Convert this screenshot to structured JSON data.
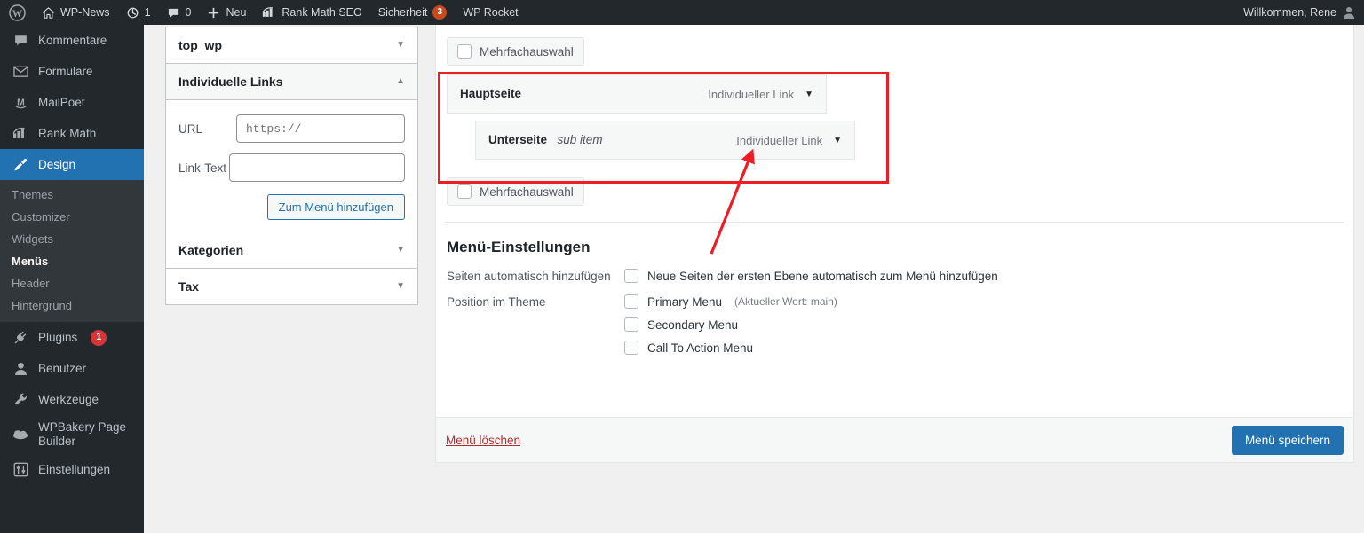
{
  "adminbar": {
    "logo": "wordpress-logo",
    "items": [
      {
        "icon": "home-icon",
        "label": "WP-News"
      },
      {
        "icon": "update-icon",
        "label": "1"
      },
      {
        "icon": "comment-icon",
        "label": "0"
      },
      {
        "icon": "plus-icon",
        "label": "Neu"
      },
      {
        "icon": "rankmath-icon",
        "label": "Rank Math SEO"
      },
      {
        "icon": "",
        "label": "Sicherheit",
        "badge": "3"
      },
      {
        "icon": "",
        "label": "WP Rocket"
      }
    ],
    "greeting": "Willkommen, Rene"
  },
  "sidebar": {
    "items": [
      {
        "label": "Kommentare",
        "icon": "comment-icon"
      },
      {
        "label": "Formulare",
        "icon": "envelope-icon"
      },
      {
        "label": "MailPoet",
        "icon": "mailpoet-icon"
      },
      {
        "label": "Rank Math",
        "icon": "rankmath-icon"
      },
      {
        "label": "Design",
        "icon": "brush-icon",
        "current": true
      },
      {
        "label": "Plugins",
        "icon": "plug-icon",
        "badge": "1"
      },
      {
        "label": "Benutzer",
        "icon": "user-icon"
      },
      {
        "label": "Werkzeuge",
        "icon": "wrench-icon"
      },
      {
        "label": "WPBakery Page Builder",
        "icon": "cloud-icon"
      },
      {
        "label": "Einstellungen",
        "icon": "sliders-icon"
      }
    ],
    "submenu": [
      {
        "label": "Themes",
        "active": false
      },
      {
        "label": "Customizer",
        "active": false
      },
      {
        "label": "Widgets",
        "active": false
      },
      {
        "label": "Menüs",
        "active": true
      },
      {
        "label": "Header",
        "active": false
      },
      {
        "label": "Hintergrund",
        "active": false
      }
    ]
  },
  "metaboxes": {
    "top_wp": {
      "title": "top_wp",
      "toggle": "chevron-down-icon"
    },
    "custom_links": {
      "title": "Individuelle Links",
      "toggle": "chevron-up-icon",
      "url_label": "URL",
      "url_placeholder": "https://",
      "url_value": "",
      "text_label": "Link-Text",
      "text_value": "",
      "text_placeholder": "",
      "add_button": "Zum Menü hinzufügen"
    },
    "categories": {
      "title": "Kategorien",
      "toggle": "chevron-down-icon"
    },
    "tax": {
      "title": "Tax",
      "toggle": "chevron-down-icon"
    }
  },
  "menu_panel": {
    "multiselect_top": "Mehrfachauswahl",
    "multiselect_bottom": "Mehrfachauswahl",
    "items": [
      {
        "title": "Hauptseite",
        "sub": "",
        "type": "Individueller Link",
        "arrow": "chevron-down-icon",
        "depth": 0
      },
      {
        "title": "Unterseite",
        "sub": "sub item",
        "type": "Individueller Link",
        "arrow": "chevron-down-icon",
        "depth": 1
      }
    ],
    "settings": {
      "title": "Menü-Einstellungen",
      "auto_add_label": "Seiten automatisch hinzufügen",
      "auto_add_option": "Neue Seiten der ersten Ebene automatisch zum Menü hinzufügen",
      "position_label": "Position im Theme",
      "positions": [
        {
          "label": "Primary Menu",
          "hint": "(Aktueller Wert: main)"
        },
        {
          "label": "Secondary Menu",
          "hint": ""
        },
        {
          "label": "Call To Action Menu",
          "hint": ""
        }
      ]
    },
    "footer": {
      "delete": "Menü löschen",
      "save": "Menü speichern"
    }
  },
  "annotation": {
    "color": "#ee1c25",
    "shape": "rectangle-and-arrow"
  }
}
